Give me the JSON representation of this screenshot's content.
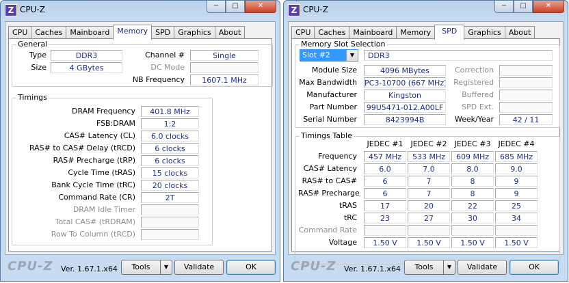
{
  "windows": [
    {
      "title": "CPU-Z",
      "tabs": [
        "CPU",
        "Caches",
        "Mainboard",
        "Memory",
        "SPD",
        "Graphics",
        "About"
      ],
      "active_tab": "Memory",
      "general": {
        "title": "General",
        "type_label": "Type",
        "type_value": "DDR3",
        "size_label": "Size",
        "size_value": "4 GBytes",
        "channel_label": "Channel #",
        "channel_value": "Single",
        "dcmode_label": "DC Mode",
        "dcmode_value": "",
        "nbfreq_label": "NB Frequency",
        "nbfreq_value": "1607.1 MHz"
      },
      "timings": {
        "title": "Timings",
        "rows": [
          {
            "label": "DRAM Frequency",
            "value": "401.8 MHz"
          },
          {
            "label": "FSB:DRAM",
            "value": "1:2"
          },
          {
            "label": "CAS# Latency (CL)",
            "value": "6.0 clocks"
          },
          {
            "label": "RAS# to CAS# Delay (tRCD)",
            "value": "6 clocks"
          },
          {
            "label": "RAS# Precharge (tRP)",
            "value": "6 clocks"
          },
          {
            "label": "Cycle Time (tRAS)",
            "value": "15 clocks"
          },
          {
            "label": "Bank Cycle Time (tRC)",
            "value": "20 clocks"
          },
          {
            "label": "Command Rate (CR)",
            "value": "2T"
          },
          {
            "label": "DRAM Idle Timer",
            "value": ""
          },
          {
            "label": "Total CAS# (tRDRAM)",
            "value": ""
          },
          {
            "label": "Row To Column (tRCD)",
            "value": ""
          }
        ]
      },
      "footer": {
        "logo": "CPU-Z",
        "version": "Ver. 1.67.1.x64",
        "tools": "Tools",
        "validate": "Validate",
        "ok": "OK"
      }
    },
    {
      "title": "CPU-Z",
      "tabs": [
        "CPU",
        "Caches",
        "Mainboard",
        "Memory",
        "SPD",
        "Graphics",
        "About"
      ],
      "active_tab": "SPD",
      "slot": {
        "title": "Memory Slot Selection",
        "selected": "Slot #2",
        "type_value": "DDR3",
        "module_size_label": "Module Size",
        "module_size_value": "4096 MBytes",
        "max_bw_label": "Max Bandwidth",
        "max_bw_value": "PC3-10700 (667 MHz)",
        "manufacturer_label": "Manufacturer",
        "manufacturer_value": "Kingston",
        "part_label": "Part Number",
        "part_value": "99U5471-012.A00LF",
        "serial_label": "Serial Number",
        "serial_value": "8423994B",
        "correction_label": "Correction",
        "correction_value": "",
        "registered_label": "Registered",
        "registered_value": "",
        "buffered_label": "Buffered",
        "buffered_value": "",
        "spdext_label": "SPD Ext.",
        "spdext_value": "",
        "weekyear_label": "Week/Year",
        "weekyear_value": "42 / 11"
      },
      "timings_table": {
        "title": "Timings Table",
        "columns": [
          "JEDEC #1",
          "JEDEC #2",
          "JEDEC #3",
          "JEDEC #4"
        ],
        "rows": [
          {
            "label": "Frequency",
            "values": [
              "457 MHz",
              "533 MHz",
              "609 MHz",
              "685 MHz"
            ]
          },
          {
            "label": "CAS# Latency",
            "values": [
              "6.0",
              "7.0",
              "8.0",
              "9.0"
            ]
          },
          {
            "label": "RAS# to CAS#",
            "values": [
              "6",
              "7",
              "8",
              "9"
            ]
          },
          {
            "label": "RAS# Precharge",
            "values": [
              "6",
              "7",
              "8",
              "9"
            ]
          },
          {
            "label": "tRAS",
            "values": [
              "17",
              "20",
              "22",
              "25"
            ]
          },
          {
            "label": "tRC",
            "values": [
              "23",
              "27",
              "30",
              "34"
            ]
          },
          {
            "label": "Command Rate",
            "values": [
              "",
              "",
              "",
              ""
            ]
          },
          {
            "label": "Voltage",
            "values": [
              "1.50 V",
              "1.50 V",
              "1.50 V",
              "1.50 V"
            ]
          }
        ]
      },
      "footer": {
        "logo": "CPU-Z",
        "version": "Ver. 1.67.1.x64",
        "tools": "Tools",
        "validate": "Validate",
        "ok": "OK"
      }
    }
  ],
  "icons": {
    "app": "cpu-z-app-icon",
    "minimize": "minimize-icon",
    "maximize": "maximize-icon",
    "close": "close-icon",
    "dropdown": "chevron-down-icon"
  },
  "colors": {
    "value_text": "#1d2c8a",
    "frame": "#c7dcf1",
    "close": "#c7432b",
    "selection": "#3399ff"
  }
}
